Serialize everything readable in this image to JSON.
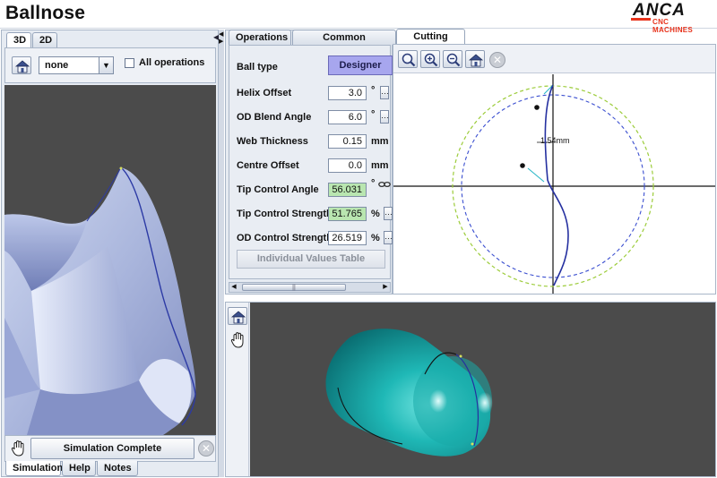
{
  "app": {
    "title": "Ballnose",
    "logo_main": "ANCA",
    "logo_sub": "CNC MACHINES"
  },
  "left_panel": {
    "view_tabs": [
      "3D",
      "2D"
    ],
    "operation_select": "none",
    "all_operations_label": "All operations",
    "all_operations_checked": false,
    "status_button": "Simulation Complete",
    "bottom_tabs": [
      "Simulation",
      "Help",
      "Notes"
    ]
  },
  "param_panel": {
    "tabs": [
      "Operations",
      "Common Parameters",
      "Cutting Edge"
    ],
    "active_tab": "Cutting Edge",
    "ball_type_label": "Ball type",
    "ball_type_value": "Designer",
    "params": [
      {
        "label": "Helix Offset",
        "value": "3.0",
        "unit": "°",
        "highlight": false
      },
      {
        "label": "OD Blend Angle",
        "value": "6.0",
        "unit": "°",
        "highlight": false
      },
      {
        "label": "Web Thickness",
        "value": "0.15",
        "unit": "mm",
        "highlight": false
      },
      {
        "label": "Centre Offset",
        "value": "0.0",
        "unit": "mm",
        "highlight": false
      },
      {
        "label": "Tip Control Angle",
        "value": "56.031",
        "unit": "°",
        "highlight": true
      },
      {
        "label": "Tip Control Strength",
        "value": "51.765",
        "unit": "%",
        "highlight": true
      },
      {
        "label": "OD Control Strength",
        "value": "26.519",
        "unit": "%",
        "highlight": false
      }
    ],
    "individual_values_button": "Individual Values Table",
    "scroll_grip": "||"
  },
  "edge_view": {
    "toolbar": [
      "zoom-fit-icon",
      "zoom-in-icon",
      "zoom-out-icon",
      "home-icon",
      "close-icon"
    ],
    "dimension_label": "1.54mm",
    "colors": {
      "curve": "#2530a0",
      "outer_circle": "#9ccc3a",
      "inner_circle": "#3b4fd0",
      "accent": "#2bb8c8"
    }
  }
}
